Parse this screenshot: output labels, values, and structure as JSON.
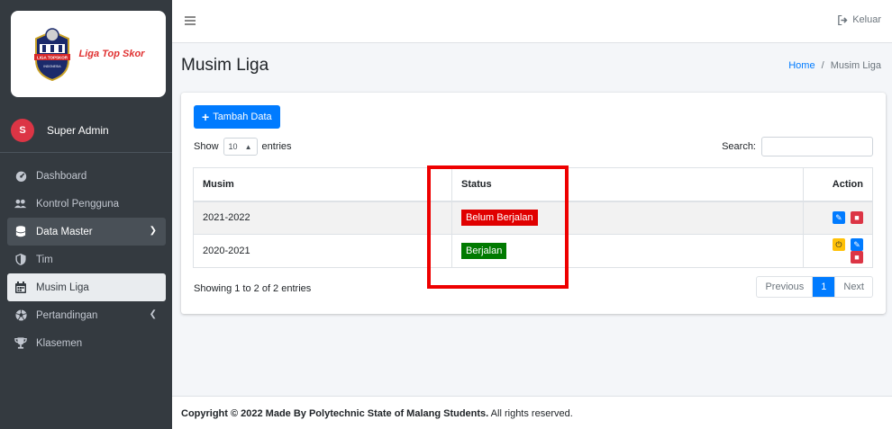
{
  "brand": {
    "text": "Liga Top Skor",
    "logo_lines": [
      "LIGA TOPSKOR",
      "INDONESIA"
    ]
  },
  "user": {
    "initial": "S",
    "name": "Super Admin"
  },
  "sidebar": {
    "items": [
      {
        "label": "Dashboard",
        "icon": "dashboard-icon"
      },
      {
        "label": "Kontrol Pengguna",
        "icon": "users-cog-icon"
      },
      {
        "label": "Data Master",
        "icon": "database-icon",
        "caret": "chevron-down"
      },
      {
        "label": "Tim",
        "icon": "shield-icon"
      },
      {
        "label": "Musim Liga",
        "icon": "calendar-icon"
      },
      {
        "label": "Pertandingan",
        "icon": "football-icon",
        "caret": "chevron-left"
      },
      {
        "label": "Klasemen",
        "icon": "trophy-icon"
      }
    ]
  },
  "navbar": {
    "logout_label": "Keluar"
  },
  "page": {
    "title": "Musim Liga",
    "breadcrumb_home": "Home",
    "breadcrumb_sep": "/",
    "breadcrumb_current": "Musim Liga"
  },
  "table_controls": {
    "add_button": "Tambah Data",
    "show_label": "Show",
    "entries_value": "10",
    "entries_label": "entries",
    "search_label": "Search:"
  },
  "table": {
    "headers": [
      "Musim",
      "Status",
      "Action"
    ],
    "rows": [
      {
        "musim": "2021-2022",
        "status": "Belum Berjalan",
        "status_color": "#e00000",
        "actions": [
          "edit",
          "delete"
        ]
      },
      {
        "musim": "2020-2021",
        "status": "Berjalan",
        "status_color": "#007a00",
        "actions": [
          "power",
          "edit",
          "delete"
        ]
      }
    ],
    "info": "Showing 1 to 2 of 2 entries"
  },
  "pagination": {
    "previous": "Previous",
    "current": "1",
    "next": "Next"
  },
  "footer": {
    "bold": "Copyright © 2022 Made By Polytechnic State of Malang Students.",
    "rest": " All rights reserved."
  },
  "colors": {
    "sidebar": "#343a40",
    "primary": "#007bff",
    "highlight": "#ee0000"
  }
}
